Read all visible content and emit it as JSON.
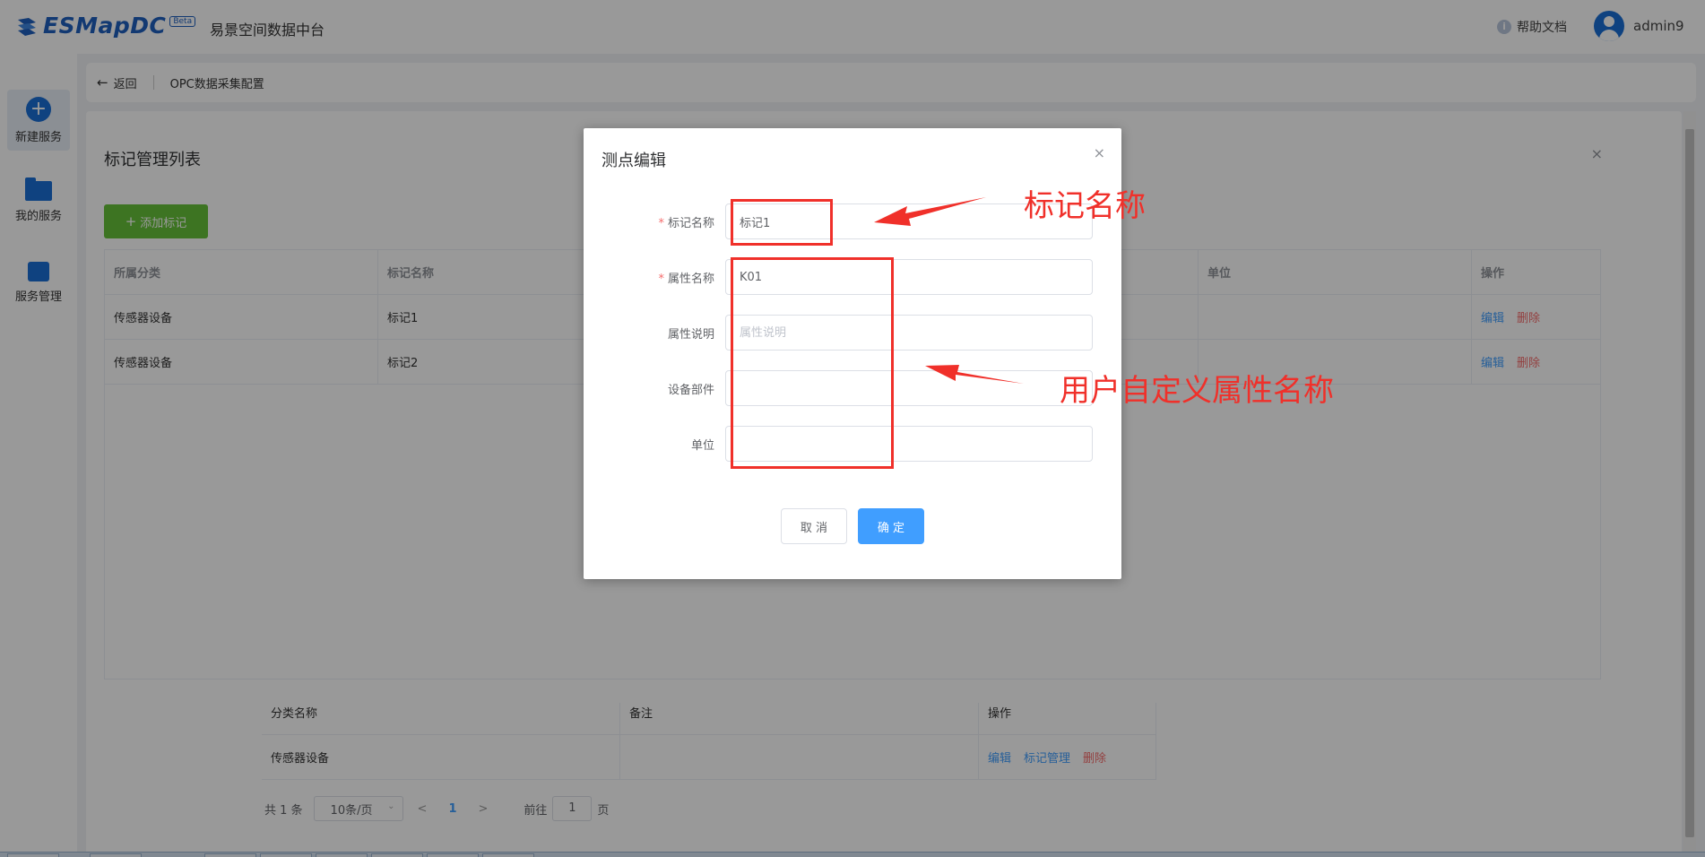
{
  "header": {
    "logo_text": "ESMapDC",
    "logo_badge": "Beta",
    "app_title": "易景空间数据中台",
    "help_label": "帮助文档",
    "username": "admin9"
  },
  "sidebar": {
    "items": [
      {
        "label": "新建服务"
      },
      {
        "label": "我的服务"
      },
      {
        "label": "服务管理"
      }
    ]
  },
  "breadcrumb": {
    "back_label": "返回",
    "current": "OPC数据采集配置"
  },
  "bottom_table": {
    "headers": [
      "分类名称",
      "备注",
      "操作"
    ],
    "rows": [
      {
        "name": "传感器设备",
        "remark": "",
        "actions": [
          "编辑",
          "标记管理",
          "删除"
        ]
      }
    ]
  },
  "pagination": {
    "total": "共 1 条",
    "page_size": "10条/页",
    "prev": "<",
    "current_page": "1",
    "next": ">",
    "goto_label": "前往",
    "goto_value": "1",
    "page_suffix": "页"
  },
  "mark_panel": {
    "title": "标记管理列表",
    "close": "×",
    "add_button": "添加标记",
    "columns": [
      "所属分类",
      "标记名称",
      "",
      "",
      "单位",
      "操作"
    ],
    "rows": [
      {
        "category": "传感器设备",
        "name": "标记1",
        "unit": "",
        "edit": "编辑",
        "delete": "删除"
      },
      {
        "category": "传感器设备",
        "name": "标记2",
        "unit": "",
        "edit": "编辑",
        "delete": "删除"
      }
    ]
  },
  "modal": {
    "title": "测点编辑",
    "close": "×",
    "fields": [
      {
        "label": "标记名称",
        "required": true,
        "value": "标记1",
        "placeholder": ""
      },
      {
        "label": "属性名称",
        "required": true,
        "value": "K01",
        "placeholder": ""
      },
      {
        "label": "属性说明",
        "required": false,
        "value": "",
        "placeholder": "属性说明"
      },
      {
        "label": "设备部件",
        "required": false,
        "value": "",
        "placeholder": ""
      },
      {
        "label": "单位",
        "required": false,
        "value": "",
        "placeholder": ""
      }
    ],
    "cancel_label": "取 消",
    "ok_label": "确 定"
  },
  "annotations": {
    "label_1": "标记名称",
    "label_2": "用户自定义属性名称",
    "color": "#f0302a"
  },
  "colors": {
    "primary": "#409eff",
    "success": "#67c23a",
    "danger": "#f56c6c",
    "brand": "#1a6fd6"
  }
}
